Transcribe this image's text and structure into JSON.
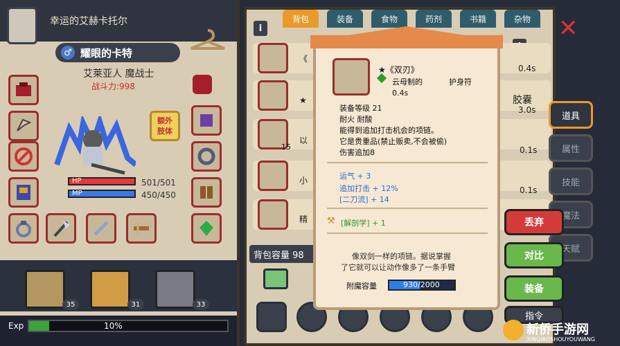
{
  "character": {
    "header_name": "幸运的艾赫卡托尔",
    "title": "耀眼的卡特",
    "race_class": "艾莱亚人 魔战士",
    "power": "战斗力:998",
    "extra_attr_label": "额外\n肢体",
    "hp_label": "HP",
    "mp_label": "MP",
    "hp_text": "501/501",
    "mp_text": "450/450"
  },
  "party": [
    {
      "level": "35"
    },
    {
      "level": "31"
    },
    {
      "level": "33"
    }
  ],
  "exp": {
    "label": "Exp",
    "percent": "10%",
    "fill": 0.1
  },
  "tabs": [
    "背包",
    "装备",
    "食物",
    "药剂",
    "书籍",
    "杂物"
  ],
  "inventory": {
    "rows": [
      {
        "text": "《",
        "right": "0.4s"
      },
      {
        "text": "★",
        "right": "胶囊",
        "right2": "3.0s"
      },
      {
        "text": "以",
        "count": "15",
        "right": "0.1s"
      },
      {
        "text": "小",
        "right": "0.1s"
      },
      {
        "text": "精",
        "right": ""
      }
    ],
    "capacity_label": "背包容量 98"
  },
  "tooltip": {
    "name": "★《双刃》",
    "material": "云母制的",
    "category": "护身符",
    "time": "0.4s",
    "equip_level": "装备等级 21",
    "traits": "耐火 耐酸",
    "desc1": "能得到追加打击机会的项链。",
    "desc2": "它是贵重品(禁止贩卖,不会被偷)",
    "desc3": "伤害追加8",
    "bonus": [
      "运气 + 3",
      "追加打击 + 12%",
      "[二刀流] + 14"
    ],
    "skill": "[解剖学] + 1",
    "flavor1": "像双剑一样的项链。据说掌握",
    "flavor2": "了它就可以让动作像多了一条手臂",
    "mana_label": "附魔容量",
    "mana_value": "930/2000",
    "mana_fill": 0.465
  },
  "side_tabs": [
    "道具",
    "属性",
    "技能",
    "魔法",
    "天赋"
  ],
  "actions": {
    "discard": "丢弃",
    "compare": "对比",
    "equip": "装备",
    "command": "指令"
  },
  "watermark": "新侨手游网",
  "watermark_sub": "XINQIAOSHOUYOUWANG"
}
